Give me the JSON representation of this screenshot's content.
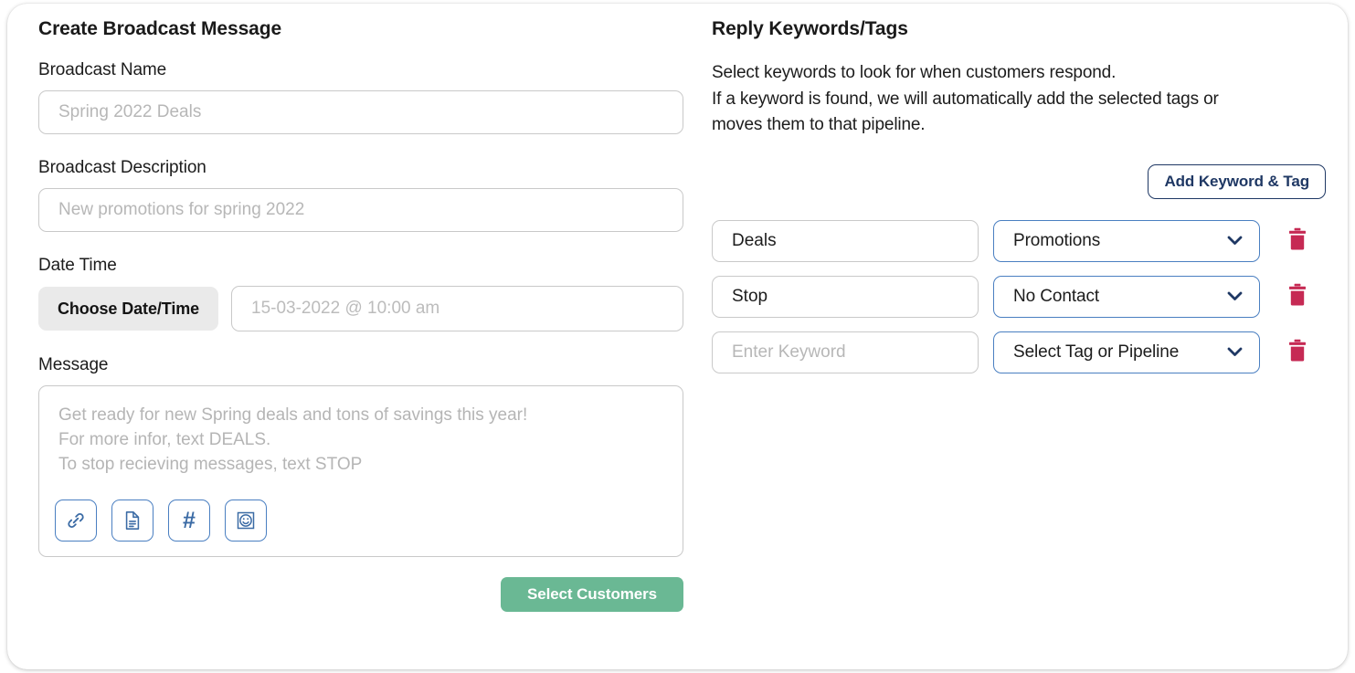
{
  "left_panel": {
    "title": "Create Broadcast Message",
    "broadcast_name": {
      "label": "Broadcast Name",
      "placeholder": "Spring 2022 Deals",
      "value": ""
    },
    "broadcast_description": {
      "label": "Broadcast Description",
      "placeholder": "New promotions for spring 2022",
      "value": ""
    },
    "date_time": {
      "label": "Date Time",
      "choose_button": "Choose Date/Time",
      "placeholder": "15-03-2022 @ 10:00 am",
      "value": ""
    },
    "message": {
      "label": "Message",
      "placeholder_lines": [
        "Get ready for new Spring deals and tons of savings this year!",
        "For more infor, text DEALS.",
        "To stop recieving messages, text STOP"
      ],
      "toolbar": [
        {
          "icon": "link-icon"
        },
        {
          "icon": "document-icon"
        },
        {
          "icon": "hashtag-icon",
          "glyph": "#"
        },
        {
          "icon": "emoji-icon"
        }
      ]
    },
    "submit_button": "Select Customers"
  },
  "right_panel": {
    "title": "Reply Keywords/Tags",
    "description_lines": [
      "Select keywords to look for when customers respond.",
      "If a keyword is found, we will automatically add the selected tags or",
      "moves them to that pipeline."
    ],
    "add_button": "Add Keyword & Tag",
    "keyword_placeholder": "Enter Keyword",
    "rows": [
      {
        "keyword": "Deals",
        "keyword_is_placeholder": false,
        "tag": "Promotions"
      },
      {
        "keyword": "Stop",
        "keyword_is_placeholder": false,
        "tag": "No Contact"
      },
      {
        "keyword": "Enter Keyword",
        "keyword_is_placeholder": true,
        "tag": "Select Tag or Pipeline"
      }
    ]
  },
  "colors": {
    "green_button": "#6ab894",
    "navy": "#1f3864",
    "blue_border": "#4a7fc1",
    "trash_red": "#c62a54",
    "input_border": "#c9c9c9",
    "placeholder_text": "#b7b7b7"
  }
}
